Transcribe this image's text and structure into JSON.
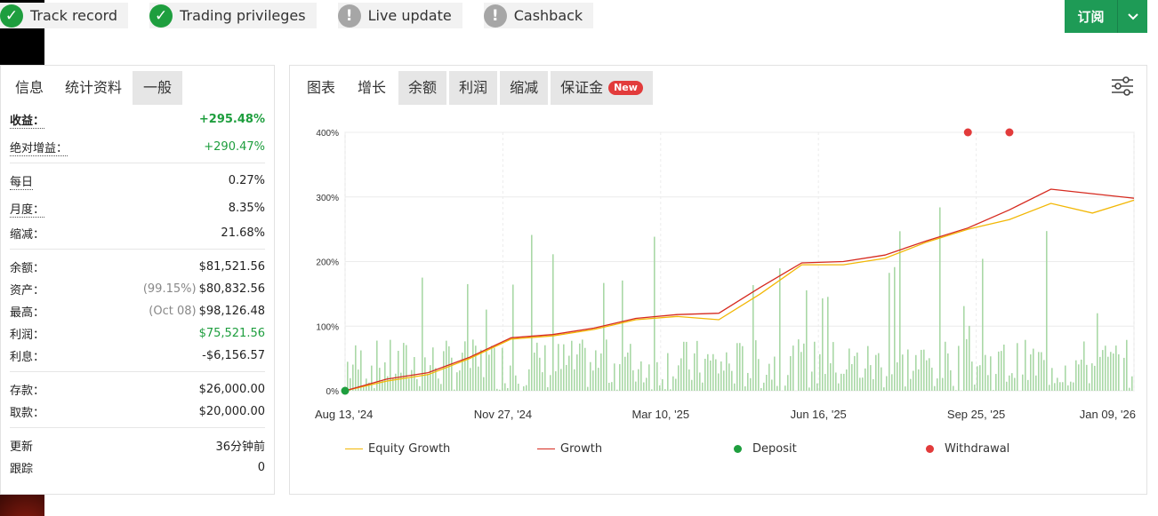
{
  "badges": [
    {
      "label": "Track record",
      "status": "ok",
      "icon": "check-icon"
    },
    {
      "label": "Trading privileges",
      "status": "ok",
      "icon": "check-icon"
    },
    {
      "label": "Live update",
      "status": "warn",
      "icon": "exclamation-icon"
    },
    {
      "label": "Cashback",
      "status": "warn",
      "icon": "exclamation-icon"
    }
  ],
  "subscribe": {
    "label": "订阅",
    "dropdown_icon": "chevron-down-icon"
  },
  "left_panel": {
    "tabs": [
      {
        "label": "信息"
      },
      {
        "label": "统计资料"
      },
      {
        "label": "一般"
      }
    ],
    "stats": {
      "gain": {
        "label": "收益：",
        "value": "+295.48%"
      },
      "abs_gain": {
        "label": "绝对增益：",
        "value": "+290.47%"
      },
      "daily": {
        "label": "每日",
        "value": "0.27%"
      },
      "monthly": {
        "label": "月度：",
        "value": "8.35%"
      },
      "drawdown": {
        "label": "缩减：",
        "value": "21.68%"
      },
      "balance": {
        "label": "余额：",
        "value": "$81,521.56"
      },
      "equity": {
        "label": "资产：",
        "pre": "(99.15%)",
        "value": "$80,832.56"
      },
      "highest": {
        "label": "最高：",
        "pre": "(Oct 08)",
        "value": "$98,126.48"
      },
      "profit": {
        "label": "利润：",
        "value": "$75,521.56"
      },
      "interest": {
        "label": "利息：",
        "value": "-$6,156.57"
      },
      "deposits": {
        "label": "存款：",
        "value": "$26,000.00"
      },
      "withdrawals": {
        "label": "取款：",
        "value": "$20,000.00"
      },
      "updated": {
        "label": "更新",
        "value": "36分钟前"
      },
      "tracking": {
        "label": "跟踪",
        "value": "0"
      }
    }
  },
  "right_panel": {
    "tabs": [
      {
        "label": "图表"
      },
      {
        "label": "增长"
      },
      {
        "label": "余额"
      },
      {
        "label": "利润"
      },
      {
        "label": "缩减"
      },
      {
        "label": "保证金"
      }
    ],
    "new_badge": "New",
    "settings_icon": "sliders-icon"
  },
  "colors": {
    "green": "#1e9e3e",
    "brand": "#1e9b56",
    "growth": "#d62a1f",
    "equity": "#f2b705",
    "bars": "#a9d8a6",
    "deposit": "#1e9e3e",
    "withdrawal": "#e23b3b"
  },
  "chart_data": {
    "type": "line",
    "x_ticks": [
      "Aug 13, '24",
      "Nov 27, '24",
      "Mar 10, '25",
      "Jun 16, '25",
      "Sep 25, '25",
      "Jan 09, '26"
    ],
    "y_ticks": [
      "0%",
      "100%",
      "200%",
      "300%",
      "400%"
    ],
    "ylim": [
      0,
      400
    ],
    "grid": true,
    "legend_position": "bottom",
    "series": [
      {
        "name": "Equity Growth",
        "values": [
          0,
          15,
          25,
          50,
          80,
          85,
          95,
          110,
          115,
          110,
          150,
          195,
          195,
          205,
          230,
          250,
          265,
          290,
          275,
          295
        ]
      },
      {
        "name": "Growth",
        "values": [
          0,
          18,
          28,
          52,
          82,
          87,
          97,
          112,
          118,
          120,
          160,
          198,
          200,
          210,
          232,
          252,
          280,
          312,
          305,
          298
        ]
      }
    ],
    "markers": [
      {
        "name": "Deposit",
        "x_index": 0,
        "value": 0
      },
      {
        "name": "Withdrawal",
        "x_index": 15,
        "value": 400
      },
      {
        "name": "Withdrawal",
        "x_index": 16,
        "value": 400
      }
    ]
  }
}
